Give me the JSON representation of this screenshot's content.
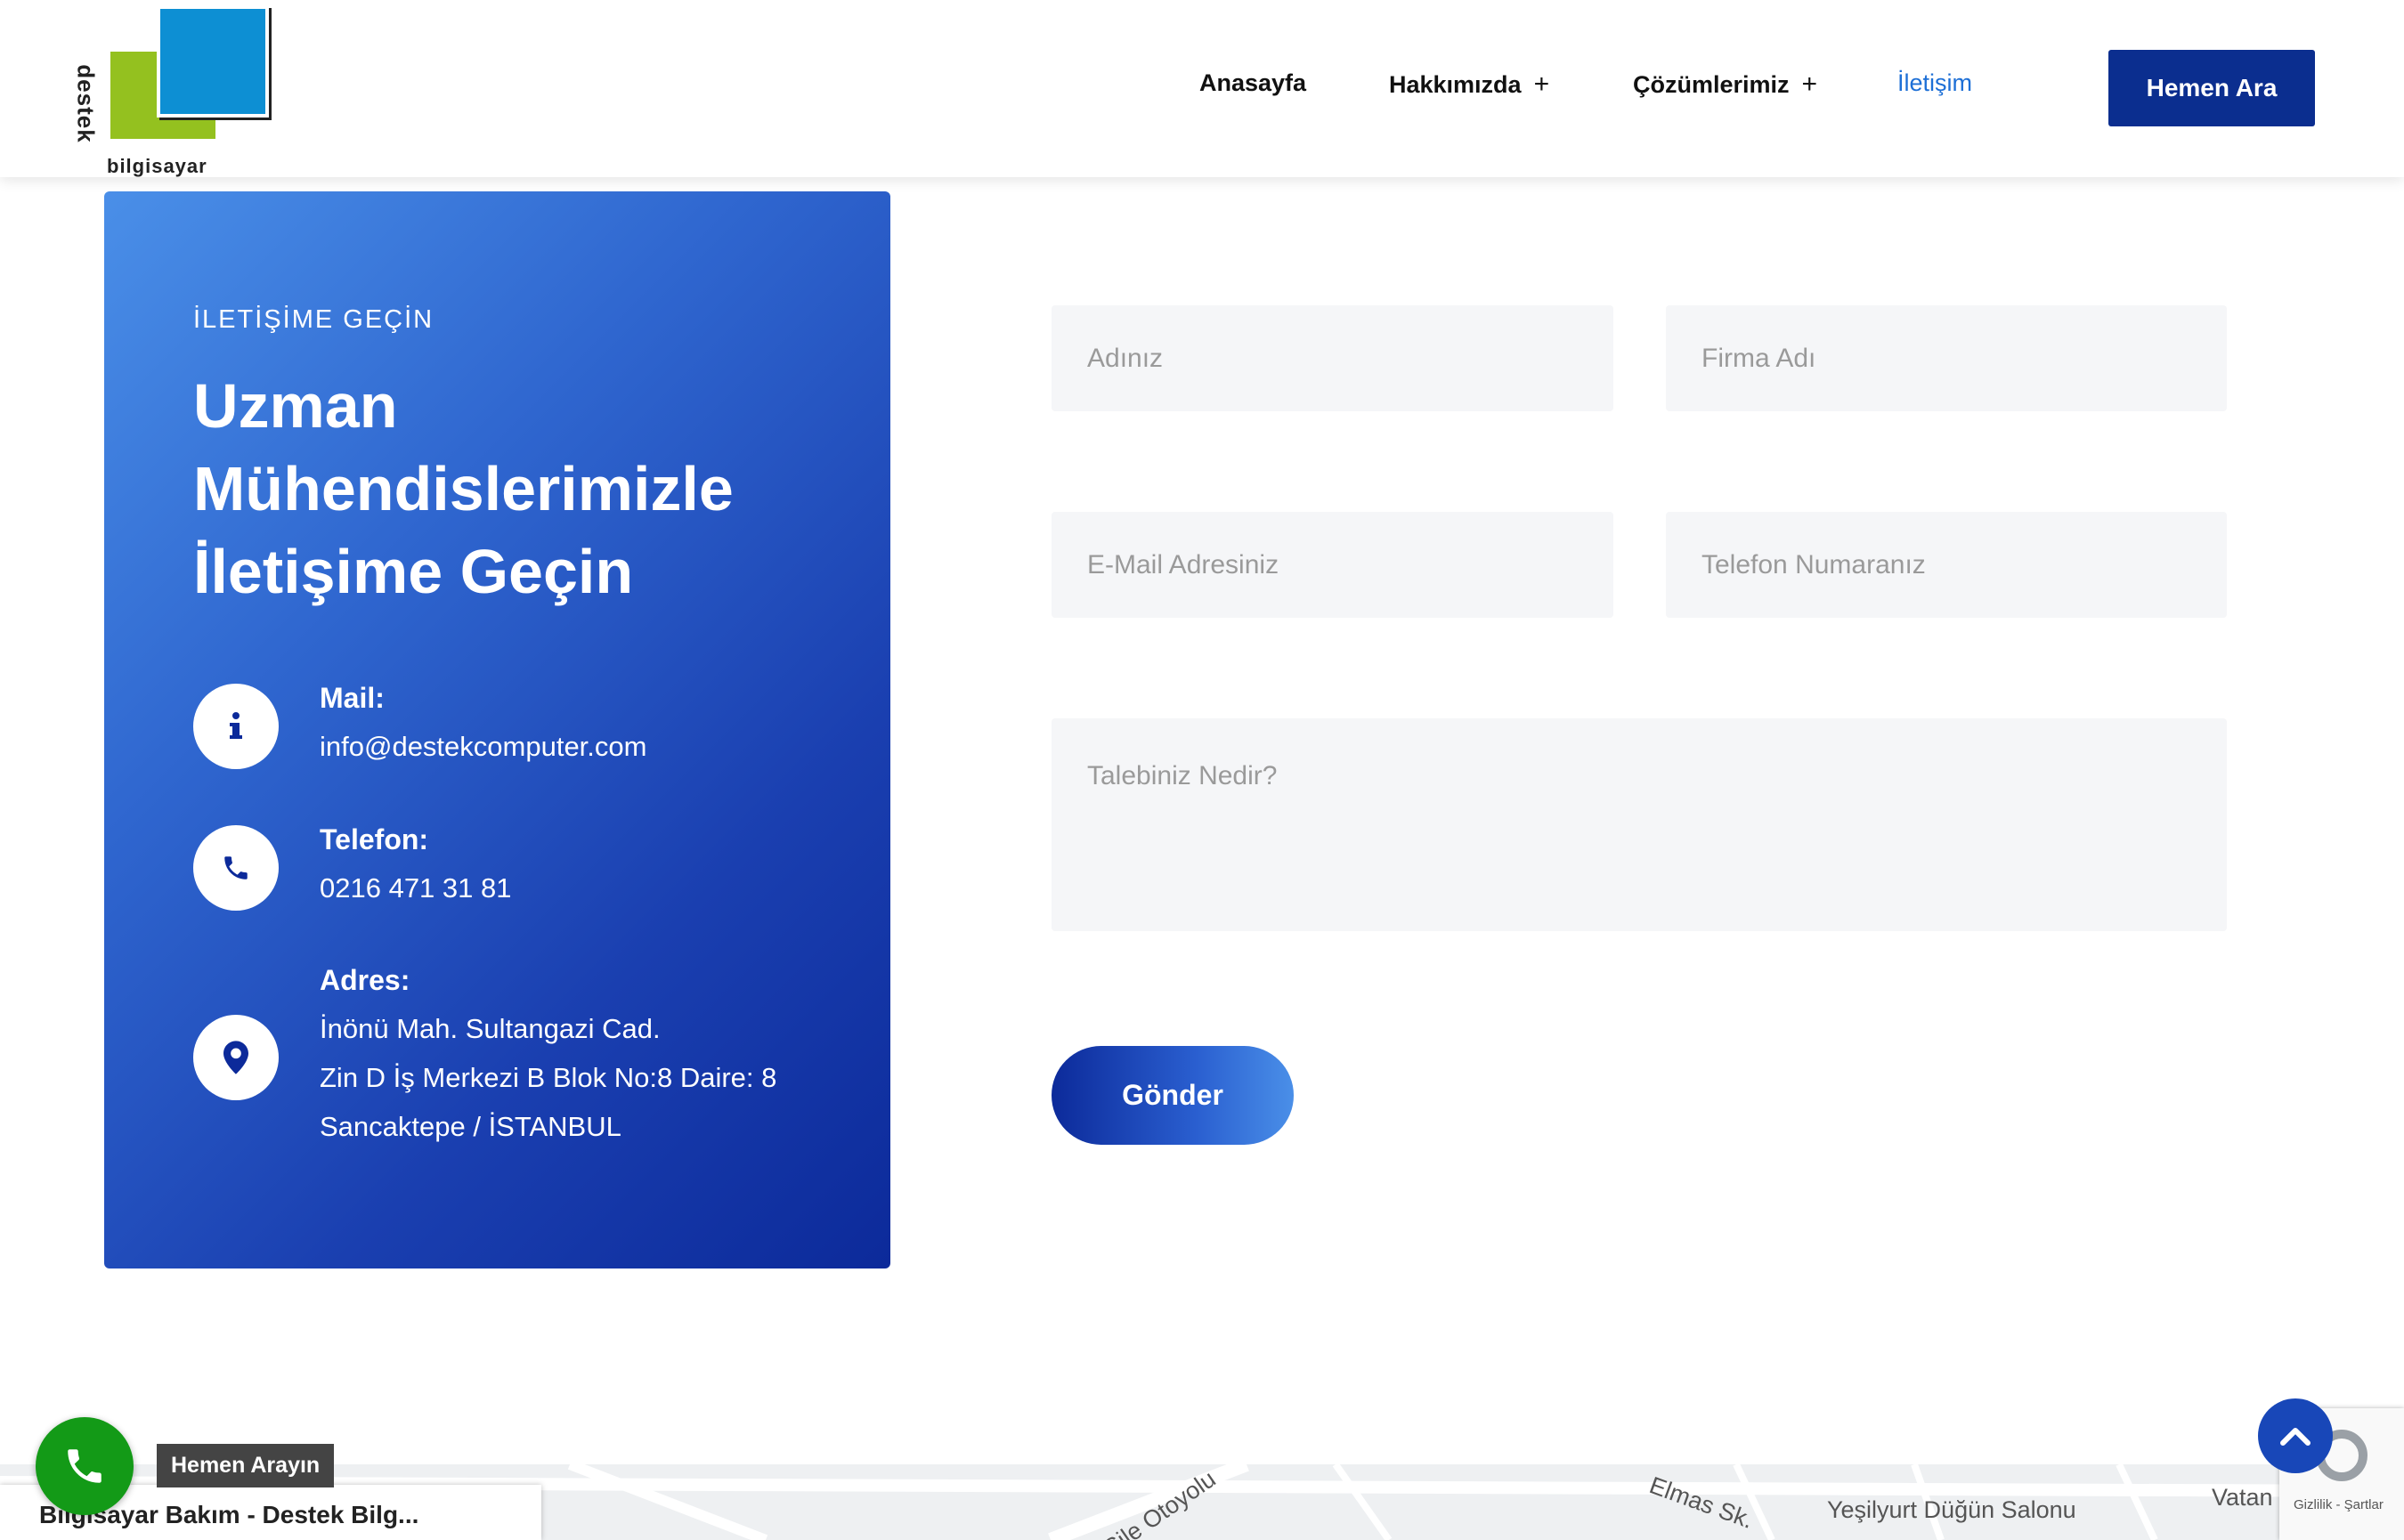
{
  "brand": {
    "logo_vertical": "destek",
    "logo_bottom": "bilgisayar"
  },
  "nav": {
    "items": [
      {
        "label": "Anasayfa",
        "has_dropdown": false
      },
      {
        "label": "Hakkımızda",
        "has_dropdown": true
      },
      {
        "label": "Çözümlerimiz",
        "has_dropdown": true
      },
      {
        "label": "İletişim",
        "has_dropdown": false,
        "active": true
      }
    ],
    "plus_symbol": "+",
    "cta": "Hemen Ara"
  },
  "contact_card": {
    "eyebrow": "İLETİŞİME GEÇİN",
    "headline": [
      "Uzman",
      "Mühendislerimizle",
      "İletişime Geçin"
    ],
    "mail_label": "Mail:",
    "mail_value": "info@destekcomputer.com",
    "phone_label": "Telefon:",
    "phone_value": "0216 471 31 81",
    "address_label": "Adres:",
    "address_lines": [
      "İnönü Mah. Sultangazi Cad.",
      "Zin D İş Merkezi B Blok No:8 Daire: 8",
      "Sancaktepe / İSTANBUL"
    ],
    "icons": [
      "info-icon",
      "phone-icon",
      "map-pin-icon"
    ]
  },
  "form": {
    "name_placeholder": "Adınız",
    "company_placeholder": "Firma Adı",
    "email_placeholder": "E-Mail Adresiniz",
    "phone_placeholder": "Telefon Numaranız",
    "message_placeholder": "Talebiniz Nedir?",
    "submit_label": "Gönder"
  },
  "map": {
    "place_card_title": "Bilgisayar Bakım - Destek Bilg...",
    "labels": [
      "Şile Otoyolu",
      "Elmas Sk.",
      "Yeşilyurt Düğün Salonu",
      "Vatan"
    ]
  },
  "floating": {
    "call_tooltip": "Hemen Arayın",
    "recaptcha_text": "Gizlilik - Şartlar"
  },
  "colors": {
    "primary_dark": "#0b2e8f",
    "primary_light": "#4a8fe8",
    "nav_active": "#1d6fd6",
    "field_bg": "#f5f6f8",
    "whatsapp_green": "#139a17"
  }
}
